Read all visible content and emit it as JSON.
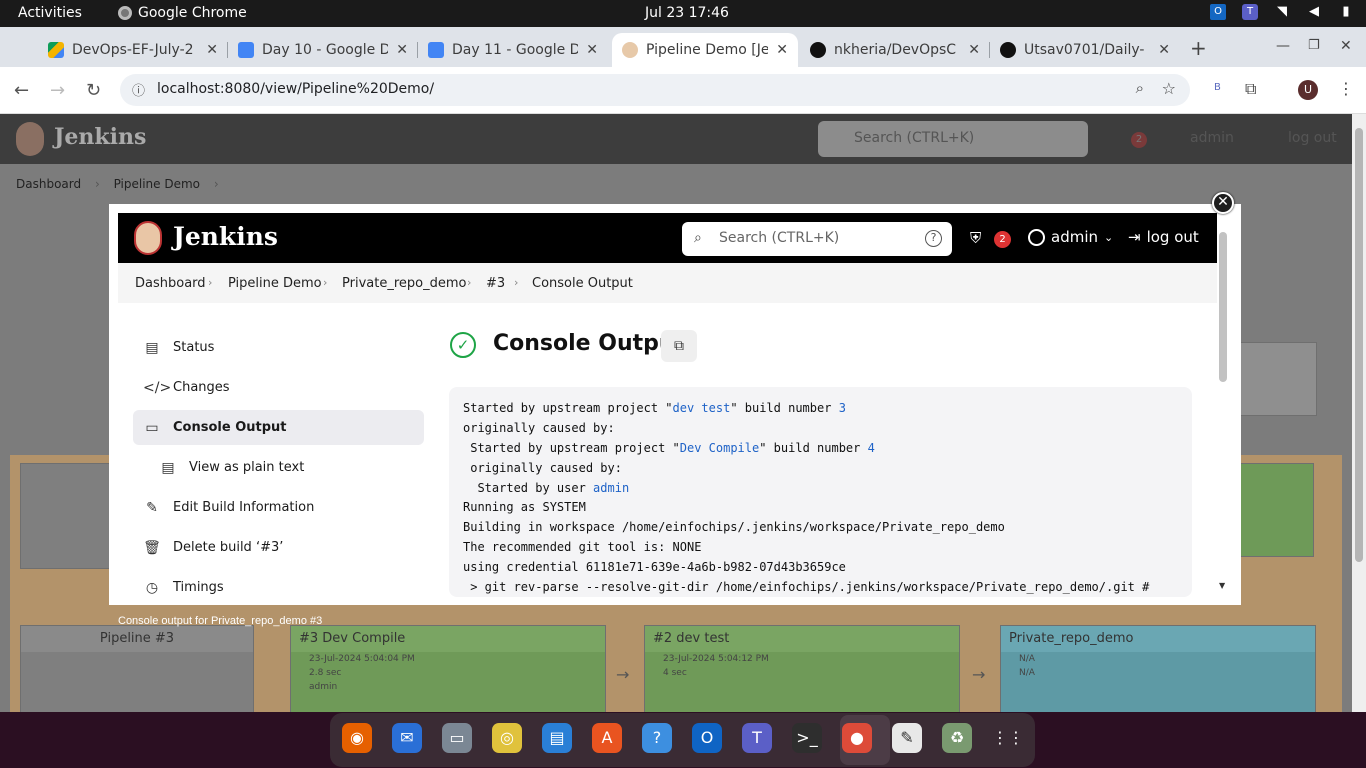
{
  "topbar": {
    "activities": "Activities",
    "app_name": "Google Chrome",
    "clock": "Jul 23  17:46"
  },
  "tabs": [
    {
      "title": "DevOps-EF-July-2",
      "icon": "google-drive-icon",
      "color": "#f4b400"
    },
    {
      "title": "Day 10 - Google D",
      "icon": "google-docs-icon",
      "color": "#4285f4"
    },
    {
      "title": "Day 11 - Google D",
      "icon": "google-docs-icon",
      "color": "#4285f4"
    },
    {
      "title": "Pipeline Demo [Je",
      "icon": "jenkins-icon",
      "color": "#d24939"
    },
    {
      "title": "nkheria/DevOpsC",
      "icon": "github-icon",
      "color": "#111111"
    },
    {
      "title": "Utsav0701/Daily-",
      "icon": "github-icon",
      "color": "#111111"
    }
  ],
  "address": {
    "url": "localhost:8080/view/Pipeline%20Demo/",
    "profile_initial": "U",
    "ext_letter": "B"
  },
  "bg_page": {
    "brand": "Jenkins",
    "search_placeholder": "Search (CTRL+K)",
    "badge": "2",
    "user": "admin",
    "logout": "log out",
    "crumbs": [
      "Dashboard",
      "Pipeline Demo"
    ],
    "pipeline_boxes": [
      {
        "title": "Pipeline #3"
      },
      {
        "title": "#3 Dev Compile",
        "date": "23-Jul-2024 5:04:04 PM",
        "duration": "2.8 sec",
        "user": "admin"
      },
      {
        "title": "#2 dev test",
        "date": "23-Jul-2024 5:04:12 PM",
        "duration": "4 sec"
      },
      {
        "title": "Private_repo_demo",
        "date": "N/A",
        "duration": "N/A"
      }
    ]
  },
  "modal": {
    "brand": "Jenkins",
    "search_placeholder": "Search (CTRL+K)",
    "security_badge": "2",
    "user": "admin",
    "logout": "log out",
    "breadcrumbs": [
      "Dashboard",
      "Pipeline Demo",
      "Private_repo_demo",
      "#3",
      "Console Output"
    ],
    "side_nav": [
      {
        "label": "Status",
        "icon": "document-icon"
      },
      {
        "label": "Changes",
        "icon": "code-icon"
      },
      {
        "label": "Console Output",
        "icon": "terminal-icon",
        "selected": true
      },
      {
        "label": "View as plain text",
        "icon": "text-file-icon",
        "sub": true
      },
      {
        "label": "Edit Build Information",
        "icon": "edit-icon"
      },
      {
        "label": "Delete build ‘#3’",
        "icon": "trash-icon"
      },
      {
        "label": "Timings",
        "icon": "clock-icon"
      }
    ],
    "title": "Console Output",
    "console_lines": [
      [
        "Started by upstream project \"",
        {
          "link": "dev test"
        },
        "\" build number ",
        {
          "link": "3"
        }
      ],
      [
        "originally caused by:"
      ],
      [
        " Started by upstream project \"",
        {
          "link": "Dev Compile"
        },
        "\" build number ",
        {
          "link": "4"
        }
      ],
      [
        " originally caused by:"
      ],
      [
        "  Started by user ",
        {
          "link": "admin"
        }
      ],
      [
        "Running as SYSTEM"
      ],
      [
        "Building in workspace /home/einfochips/.jenkins/workspace/Private_repo_demo"
      ],
      [
        "The recommended git tool is: NONE"
      ],
      [
        "using credential 61181e71-639e-4a6b-b982-07d43b3659ce"
      ],
      [
        " > git rev-parse --resolve-git-dir /home/einfochips/.jenkins/workspace/Private_repo_demo/.git #"
      ]
    ]
  },
  "status_bar": "Console output for Private_repo_demo #3",
  "dock": [
    "firefox",
    "thunderbird",
    "files",
    "rhythmbox",
    "libreoffice-writer",
    "app-center",
    "help",
    "outlook",
    "teams",
    "terminal",
    "chrome",
    "text-editor",
    "trash",
    "show-apps"
  ]
}
